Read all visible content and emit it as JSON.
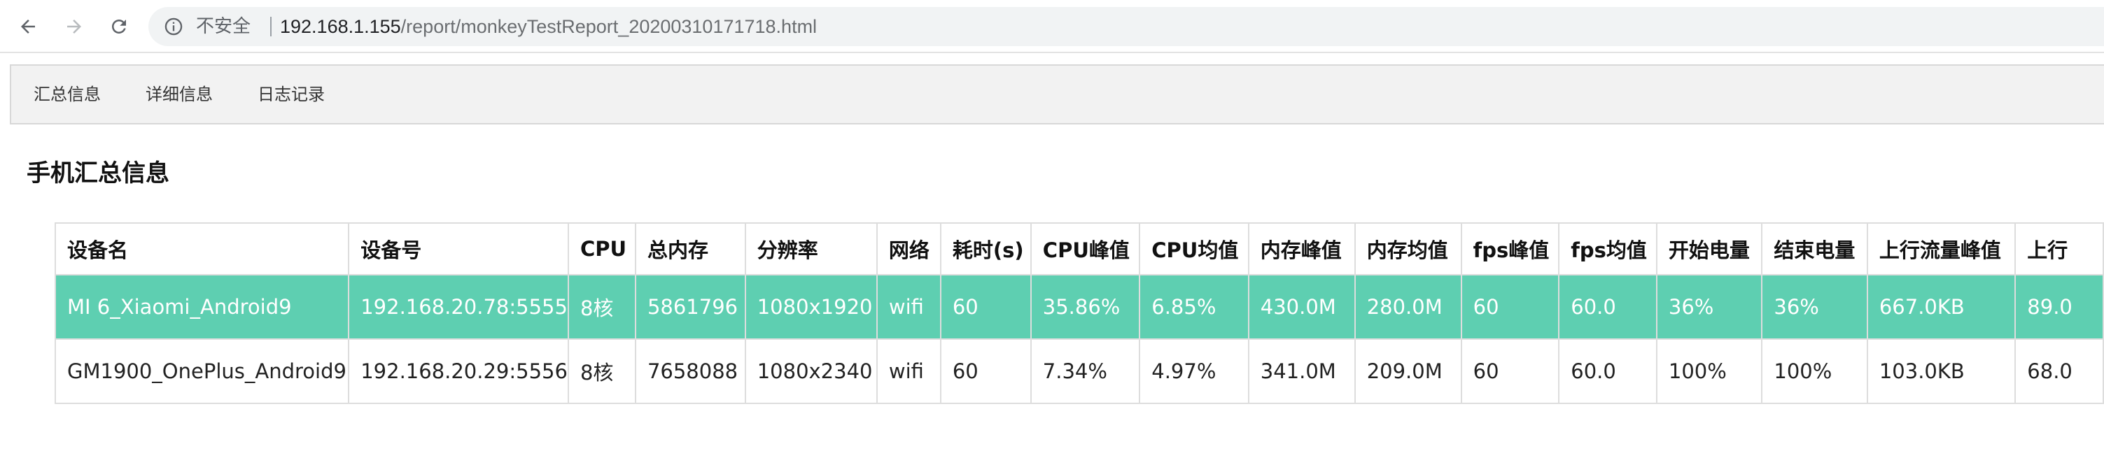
{
  "browser": {
    "security_label": "不安全",
    "url_host": "192.168.1.155",
    "url_path": "/report/monkeyTestReport_20200310171718.html"
  },
  "tabs": [
    {
      "label": "汇总信息"
    },
    {
      "label": "详细信息"
    },
    {
      "label": "日志记录"
    }
  ],
  "section": {
    "title": "手机汇总信息"
  },
  "table": {
    "headers": [
      "设备名",
      "设备号",
      "CPU",
      "总内存",
      "分辨率",
      "网络",
      "耗时(s)",
      "CPU峰值",
      "CPU均值",
      "内存峰值",
      "内存均值",
      "fps峰值",
      "fps均值",
      "开始电量",
      "结束电量",
      "上行流量峰值",
      "上行"
    ],
    "rows": [
      [
        "MI 6_Xiaomi_Android9",
        "192.168.20.78:5555",
        "8核",
        "5861796",
        "1080x1920",
        "wifi",
        "60",
        "35.86%",
        "6.85%",
        "430.0M",
        "280.0M",
        "60",
        "60.0",
        "36%",
        "36%",
        "667.0KB",
        "89.0"
      ],
      [
        "GM1900_OnePlus_Android9",
        "192.168.20.29:5556",
        "8核",
        "7658088",
        "1080x2340",
        "wifi",
        "60",
        "7.34%",
        "4.97%",
        "341.0M",
        "209.0M",
        "60",
        "60.0",
        "100%",
        "100%",
        "103.0KB",
        "68.0"
      ]
    ],
    "highlight_color": "#5ecfb1"
  }
}
